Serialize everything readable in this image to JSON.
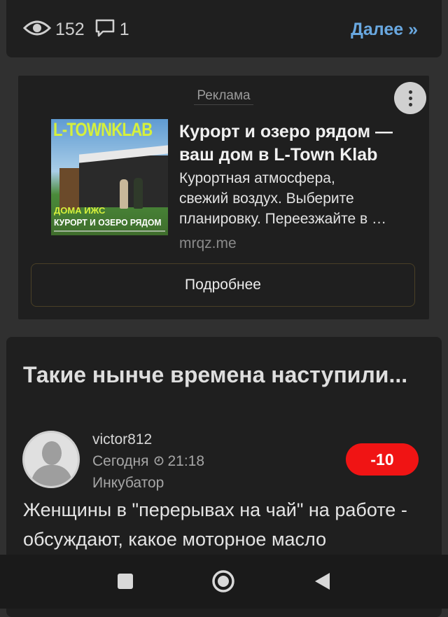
{
  "previous_post": {
    "views": "152",
    "comments": "1",
    "more_label": "Далее »"
  },
  "ad": {
    "label": "Реклама",
    "image_brand": "L-TOWNKLAB",
    "image_caption_1": "ДОМА ИЖС",
    "image_caption_2": "КУРОРТ И ОЗЕРО РЯДОМ",
    "title": "Курорт и озеро рядом — ваш дом в L-Town Klab",
    "desc_line_1": "Курортная атмосфера,",
    "desc_line_2": "свежий воздух. Выберите",
    "desc_line_3": "планировку. Переезжайте в …",
    "domain": "mrqz.me",
    "button_label": "Подробнее"
  },
  "post": {
    "title": "Такие нынче времена наступили...",
    "author": "victor812",
    "date": "Сегодня",
    "time": "21:18",
    "category": "Инкубатор",
    "rating": "-10",
    "body": "Женщины в \"перерывах на чай\" на работе - обсуждают, какое моторное масло"
  },
  "colors": {
    "accent_link": "#69a8e0",
    "rating_bg": "#f01414",
    "card_bg": "#1f1f1f",
    "page_bg": "#303030"
  },
  "icons": {
    "views": "eye-icon",
    "comments": "comment-icon",
    "kebab": "more-vertical-icon",
    "clock": "clock-icon",
    "nav_recent": "square-icon",
    "nav_home": "circle-icon",
    "nav_back": "triangle-back-icon"
  }
}
